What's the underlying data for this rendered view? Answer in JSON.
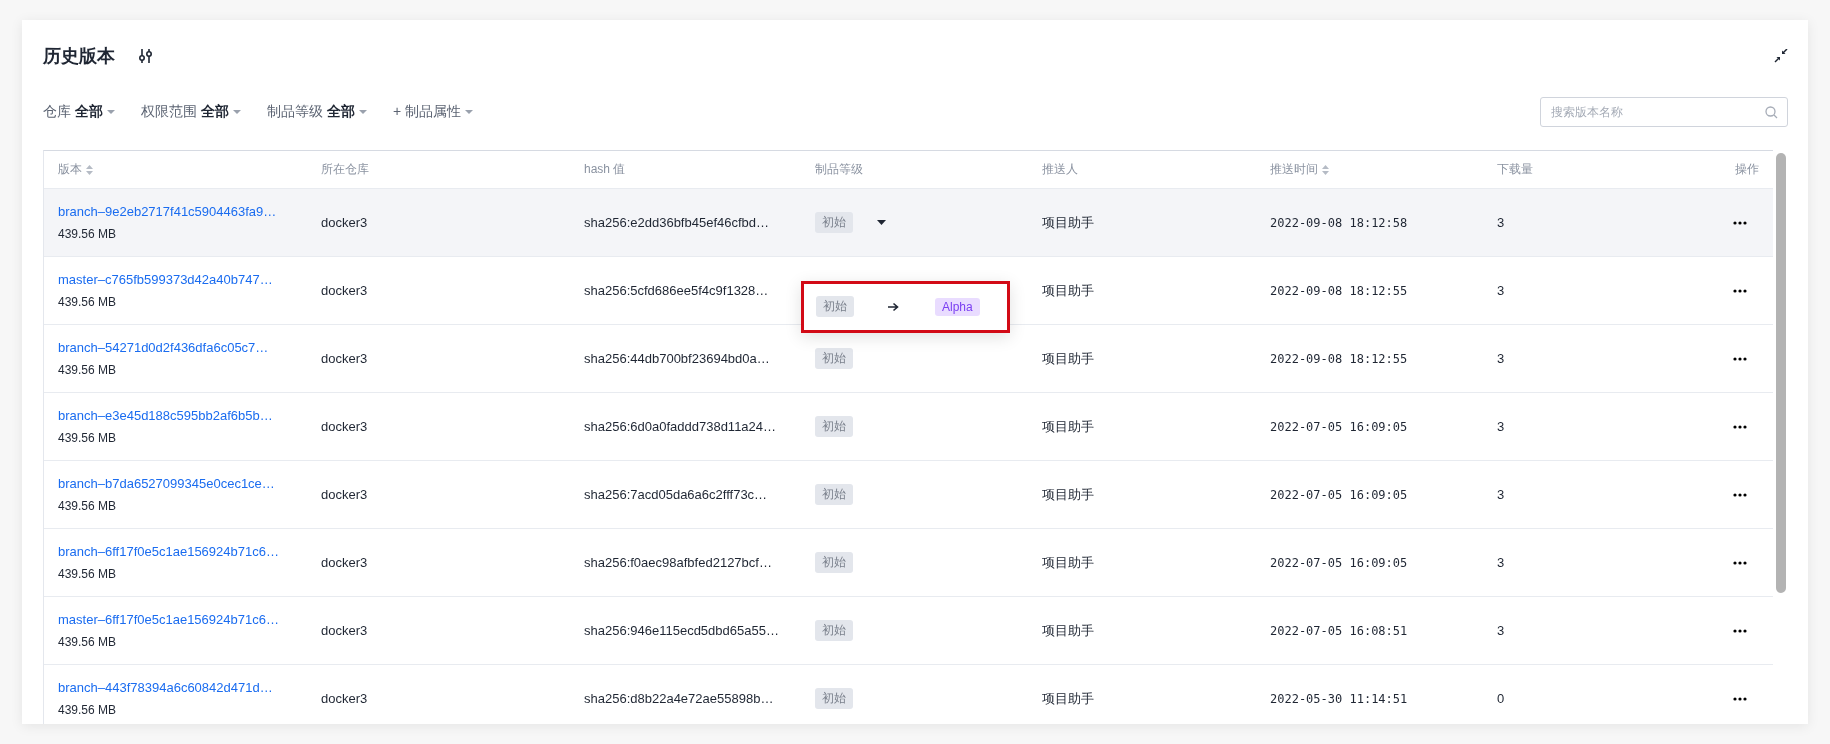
{
  "title": "历史版本",
  "filters": [
    {
      "label": "仓库",
      "value": "全部",
      "kind": "select"
    },
    {
      "label": "权限范围",
      "value": "全部",
      "kind": "select"
    },
    {
      "label": "制品等级",
      "value": "全部",
      "kind": "select"
    },
    {
      "label": "+ 制品属性",
      "kind": "add"
    }
  ],
  "search": {
    "placeholder": "搜索版本名称"
  },
  "table": {
    "columns": [
      {
        "label": "版本",
        "sortable": true
      },
      {
        "label": "所在仓库",
        "sortable": false
      },
      {
        "label": "hash 值",
        "sortable": false
      },
      {
        "label": "制品等级",
        "sortable": false
      },
      {
        "label": "推送人",
        "sortable": false
      },
      {
        "label": "推送时间",
        "sortable": true
      },
      {
        "label": "下载量",
        "sortable": false
      },
      {
        "label": "操作",
        "sortable": false
      }
    ],
    "rows": [
      {
        "version": "branch–9e2eb2717f41c5904463fa9…",
        "size": "439.56 MB",
        "repo": "docker3",
        "hash": "sha256:e2dd36bfb45ef46cfbd…",
        "level": "初始",
        "pusher": "项目助手",
        "time": "2022-09-08 18:12:58",
        "downloads": "3",
        "hovered": true
      },
      {
        "version": "master–c765fb599373d42a40b747…",
        "size": "439.56 MB",
        "repo": "docker3",
        "hash": "sha256:5cfd686ee5f4c9f1328…",
        "pusher": "项目助手",
        "time": "2022-09-08 18:12:55",
        "downloads": "3",
        "hovered": false,
        "popup": {
          "from": "初始",
          "to": "Alpha"
        }
      },
      {
        "version": "branch–54271d0d2f436dfa6c05c7…",
        "size": "439.56 MB",
        "repo": "docker3",
        "hash": "sha256:44db700bf23694bd0a…",
        "level": "初始",
        "pusher": "项目助手",
        "time": "2022-09-08 18:12:55",
        "downloads": "3",
        "hovered": false
      },
      {
        "version": "branch–e3e45d188c595bb2af6b5b…",
        "size": "439.56 MB",
        "repo": "docker3",
        "hash": "sha256:6d0a0faddd738d11a24…",
        "level": "初始",
        "pusher": "项目助手",
        "time": "2022-07-05 16:09:05",
        "downloads": "3",
        "hovered": false
      },
      {
        "version": "branch–b7da6527099345e0cec1ce…",
        "size": "439.56 MB",
        "repo": "docker3",
        "hash": "sha256:7acd05da6a6c2fff73c…",
        "level": "初始",
        "pusher": "项目助手",
        "time": "2022-07-05 16:09:05",
        "downloads": "3",
        "hovered": false
      },
      {
        "version": "branch–6ff17f0e5c1ae156924b71c6…",
        "size": "439.56 MB",
        "repo": "docker3",
        "hash": "sha256:f0aec98afbfed2127bcf…",
        "level": "初始",
        "pusher": "项目助手",
        "time": "2022-07-05 16:09:05",
        "downloads": "3",
        "hovered": false
      },
      {
        "version": "master–6ff17f0e5c1ae156924b71c6…",
        "size": "439.56 MB",
        "repo": "docker3",
        "hash": "sha256:946e115ecd5dbd65a55…",
        "level": "初始",
        "pusher": "项目助手",
        "time": "2022-07-05 16:08:51",
        "downloads": "3",
        "hovered": false
      },
      {
        "version": "branch–443f78394a6c60842d471d…",
        "size": "439.56 MB",
        "repo": "docker3",
        "hash": "sha256:d8b22a4e72ae55898b…",
        "level": "初始",
        "pusher": "项目助手",
        "time": "2022-05-30 11:14:51",
        "downloads": "0",
        "hovered": false
      }
    ]
  }
}
